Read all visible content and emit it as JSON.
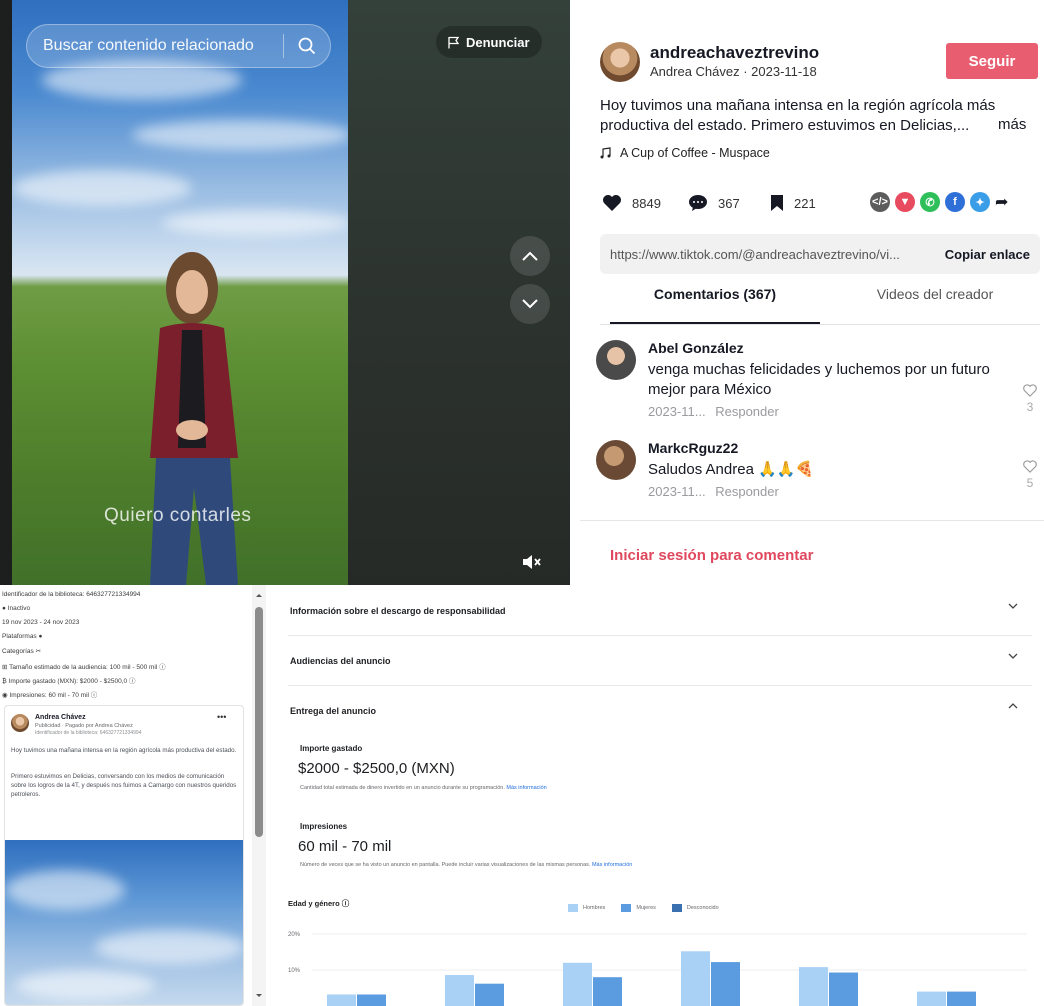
{
  "video": {
    "search_placeholder": "Buscar contenido relacionado",
    "report_label": "Denunciar",
    "caption": "Quiero contarles"
  },
  "tiktok": {
    "username": "andreachaveztrevino",
    "subtitle": "Andrea Chávez · 2023-11-18",
    "follow_label": "Seguir",
    "description": "Hoy tuvimos una mañana intensa en la región agrícola más productiva del estado. Primero estuvimos en Delicias,...",
    "more_label": "más",
    "music": "A Cup of Coffee - Muspace",
    "likes": "8849",
    "comments": "367",
    "saves": "221",
    "link": "https://www.tiktok.com/@andreachaveztrevino/vi...",
    "copy_label": "Copiar enlace",
    "tab_comments": "Comentarios (367)",
    "tab_creator": "Videos del creador",
    "comment_list": [
      {
        "name": "Abel González",
        "text": "venga muchas felicidades y luchemos por un futuro mejor para México",
        "date": "2023-11...",
        "reply": "Responder",
        "likes": "3"
      },
      {
        "name": "MarkcRguz22",
        "text": "Saludos Andrea 🙏🙏🍕",
        "date": "2023-11...",
        "reply": "Responder",
        "likes": "5"
      }
    ],
    "login_label": "Iniciar sesión para comentar",
    "colors": {
      "follow": "#e85d70",
      "login": "#e0485e"
    }
  },
  "ad_library": {
    "library_id": "Identificador de la biblioteca: 646327721334994",
    "status": "Inactivo",
    "dates": "19 nov 2023 - 24 nov 2023",
    "platforms": "Plataformas",
    "categories": "Categorías",
    "audience": "Tamaño estimado de la audiencia: 100 mil - 500 mil",
    "spend": "Importe gastado (MXN): $2000 - $2500,0",
    "impressions": "Impresiones: 60 mil - 70 mil",
    "card_name": "Andrea Chávez",
    "card_paid": "Publicidad · Pagado por Andrea Chávez",
    "card_id": "Identificador de la biblioteca: 646327721334994",
    "body_1": "Hoy tuvimos una mañana intensa en la región agrícola más productiva del estado.",
    "body_2": "Primero estuvimos en Delicias, conversando con los medios de comunicación sobre los logros de la 4T, y después nos fuimos a Camargo con nuestros queridos petroleros."
  },
  "meta": {
    "section_disclaimer": "Información sobre el descargo de responsabilidad",
    "section_audiences": "Audiencias del anuncio",
    "section_delivery": "Entrega del anuncio",
    "spend_label": "Importe gastado",
    "spend_value": "$2000 - $2500,0 (MXN)",
    "spend_note": "Cantidad total estimada de dinero invertido en un anuncio durante su programación.",
    "more_info": "Más información",
    "impressions_label": "Impresiones",
    "impressions_value": "60 mil - 70 mil",
    "impressions_note": "Número de veces que se ha visto un anuncio en pantalla. Puede incluir varias visualizaciones de las mismas personas.",
    "age_gender_title": "Edad y género"
  },
  "chart_data": {
    "type": "bar",
    "categories": [
      "",
      "",
      "",
      "",
      "",
      ""
    ],
    "series": [
      {
        "name": "Hombres",
        "color": "#a9d0f5",
        "values": [
          3.2,
          8.6,
          12.0,
          15.2,
          10.8,
          4.0
        ]
      },
      {
        "name": "Mujeres",
        "color": "#5b9be0",
        "values": [
          3.2,
          6.2,
          8.0,
          12.2,
          9.3,
          4.0
        ]
      },
      {
        "name": "Desconocido",
        "color": "#3a6fb0",
        "values": [
          0,
          0,
          0,
          0,
          0,
          0
        ]
      }
    ],
    "y_ticks": [
      "20%",
      "10%"
    ],
    "ylim": [
      0,
      25
    ],
    "legend": "top"
  }
}
